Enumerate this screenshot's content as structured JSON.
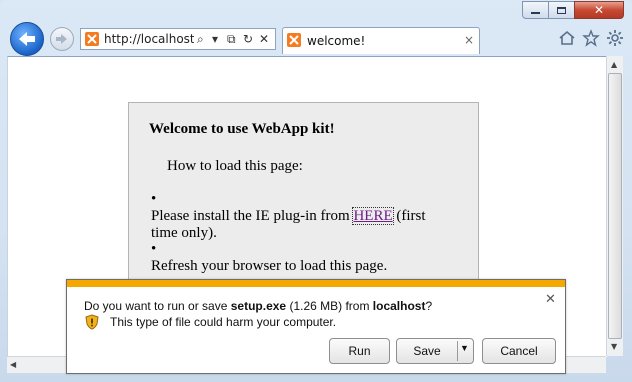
{
  "browser": {
    "address_url": "http://localhost/",
    "tab_title": "welcome!",
    "tab_close": "×",
    "tools": {
      "search": "⌕",
      "dropdown": "▾",
      "compat": "⧉",
      "refresh": "↻",
      "stop": "✕"
    }
  },
  "window_controls": {
    "minimize": "",
    "maximize": "",
    "close": "✕"
  },
  "toolbar_icons": [
    "home-icon",
    "favorites-star-icon",
    "tools-gear-icon"
  ],
  "page": {
    "heading": "Welcome to use WebApp kit!",
    "intro": "How to load this page:",
    "bullet1_before": "Please install the IE plug-in from ",
    "bullet1_link": "HERE",
    "bullet1_after": " (first time only).",
    "bullet2": "Refresh your browser to load this page.",
    "bullet_char": "•"
  },
  "download_bar": {
    "msg_prefix": "Do you want to run or save ",
    "file_name": "setup.exe",
    "file_size": " (1.26 MB) from ",
    "source": "localhost",
    "msg_suffix": "?",
    "warning": "This type of file could harm your computer.",
    "close": "✕",
    "run_label": "Run",
    "save_label": "Save",
    "save_arrow": "▼",
    "cancel_label": "Cancel",
    "accent_color": "#f4a800"
  },
  "colors": {
    "link": "#6e1f8a",
    "back_button": "#1a63c8",
    "favicon": "#f47b20"
  }
}
